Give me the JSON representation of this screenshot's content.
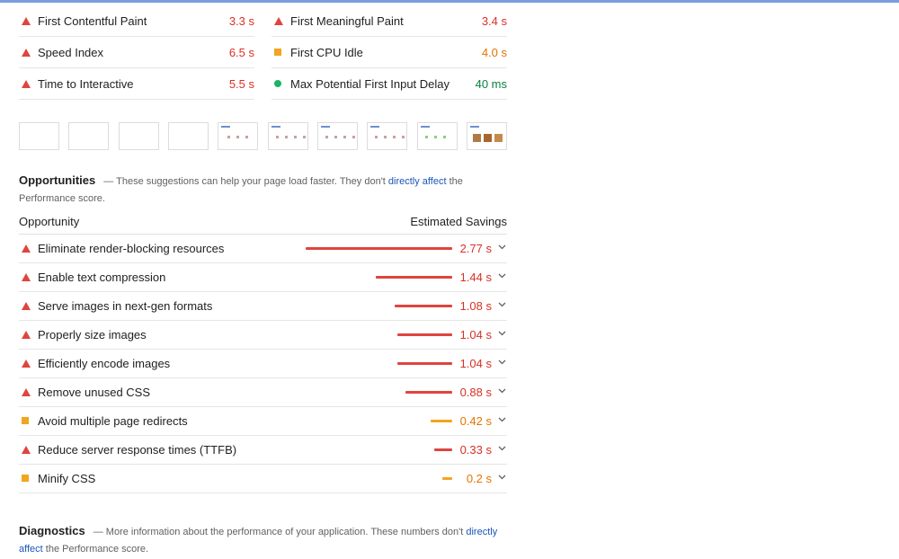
{
  "colors": {
    "red": "#d93025",
    "orange": "#e37400",
    "green": "#0b8043",
    "bar_red": "#e0443e",
    "bar_orange": "#f2a51e",
    "link": "#1a56b8"
  },
  "metrics": [
    {
      "label": "First Contentful Paint",
      "value": "3.3 s",
      "status": "fail",
      "icon": "red-triangle-icon"
    },
    {
      "label": "First Meaningful Paint",
      "value": "3.4 s",
      "status": "fail",
      "icon": "red-triangle-icon"
    },
    {
      "label": "Speed Index",
      "value": "6.5 s",
      "status": "fail",
      "icon": "red-triangle-icon"
    },
    {
      "label": "First CPU Idle",
      "value": "4.0 s",
      "status": "average",
      "icon": "orange-square-icon"
    },
    {
      "label": "Time to Interactive",
      "value": "5.5 s",
      "status": "fail",
      "icon": "red-triangle-icon"
    },
    {
      "label": "Max Potential First Input Delay",
      "value": "40 ms",
      "status": "pass",
      "icon": "green-circle-icon"
    }
  ],
  "opportunities": {
    "title": "Opportunities",
    "desc_prefix": "— These suggestions can help your page load faster. They don't ",
    "link": "directly affect",
    "desc_suffix": " the Performance score.",
    "col_left": "Opportunity",
    "col_right": "Estimated Savings",
    "items": [
      {
        "label": "Eliminate render-blocking resources",
        "value": "2.77 s",
        "status": "fail",
        "savings_fraction": 1.0
      },
      {
        "label": "Enable text compression",
        "value": "1.44 s",
        "status": "fail",
        "savings_fraction": 0.52
      },
      {
        "label": "Serve images in next-gen formats",
        "value": "1.08 s",
        "status": "fail",
        "savings_fraction": 0.39
      },
      {
        "label": "Properly size images",
        "value": "1.04 s",
        "status": "fail",
        "savings_fraction": 0.375
      },
      {
        "label": "Efficiently encode images",
        "value": "1.04 s",
        "status": "fail",
        "savings_fraction": 0.375
      },
      {
        "label": "Remove unused CSS",
        "value": "0.88 s",
        "status": "fail",
        "savings_fraction": 0.32
      },
      {
        "label": "Avoid multiple page redirects",
        "value": "0.42 s",
        "status": "average",
        "savings_fraction": 0.15
      },
      {
        "label": "Reduce server response times (TTFB)",
        "value": "0.33 s",
        "status": "fail",
        "savings_fraction": 0.12
      },
      {
        "label": "Minify CSS",
        "value": "0.2 s",
        "status": "average",
        "savings_fraction": 0.07
      }
    ]
  },
  "diagnostics": {
    "title": "Diagnostics",
    "desc_prefix": "— More information about the performance of your application. These numbers don't ",
    "link": "directly affect",
    "desc_suffix": " the Performance score."
  }
}
